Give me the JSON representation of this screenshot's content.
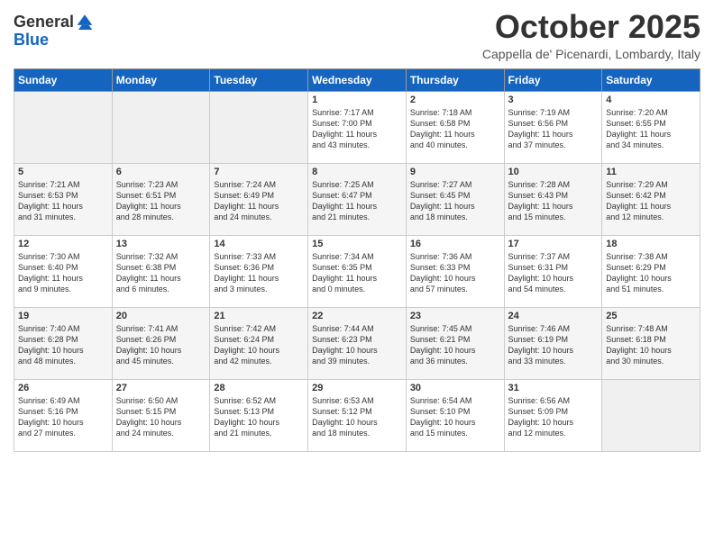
{
  "header": {
    "logo_line1": "General",
    "logo_line2": "Blue",
    "month": "October 2025",
    "location": "Cappella de' Picenardi, Lombardy, Italy"
  },
  "days_of_week": [
    "Sunday",
    "Monday",
    "Tuesday",
    "Wednesday",
    "Thursday",
    "Friday",
    "Saturday"
  ],
  "weeks": [
    [
      {
        "day": "",
        "info": ""
      },
      {
        "day": "",
        "info": ""
      },
      {
        "day": "",
        "info": ""
      },
      {
        "day": "1",
        "info": "Sunrise: 7:17 AM\nSunset: 7:00 PM\nDaylight: 11 hours\nand 43 minutes."
      },
      {
        "day": "2",
        "info": "Sunrise: 7:18 AM\nSunset: 6:58 PM\nDaylight: 11 hours\nand 40 minutes."
      },
      {
        "day": "3",
        "info": "Sunrise: 7:19 AM\nSunset: 6:56 PM\nDaylight: 11 hours\nand 37 minutes."
      },
      {
        "day": "4",
        "info": "Sunrise: 7:20 AM\nSunset: 6:55 PM\nDaylight: 11 hours\nand 34 minutes."
      }
    ],
    [
      {
        "day": "5",
        "info": "Sunrise: 7:21 AM\nSunset: 6:53 PM\nDaylight: 11 hours\nand 31 minutes."
      },
      {
        "day": "6",
        "info": "Sunrise: 7:23 AM\nSunset: 6:51 PM\nDaylight: 11 hours\nand 28 minutes."
      },
      {
        "day": "7",
        "info": "Sunrise: 7:24 AM\nSunset: 6:49 PM\nDaylight: 11 hours\nand 24 minutes."
      },
      {
        "day": "8",
        "info": "Sunrise: 7:25 AM\nSunset: 6:47 PM\nDaylight: 11 hours\nand 21 minutes."
      },
      {
        "day": "9",
        "info": "Sunrise: 7:27 AM\nSunset: 6:45 PM\nDaylight: 11 hours\nand 18 minutes."
      },
      {
        "day": "10",
        "info": "Sunrise: 7:28 AM\nSunset: 6:43 PM\nDaylight: 11 hours\nand 15 minutes."
      },
      {
        "day": "11",
        "info": "Sunrise: 7:29 AM\nSunset: 6:42 PM\nDaylight: 11 hours\nand 12 minutes."
      }
    ],
    [
      {
        "day": "12",
        "info": "Sunrise: 7:30 AM\nSunset: 6:40 PM\nDaylight: 11 hours\nand 9 minutes."
      },
      {
        "day": "13",
        "info": "Sunrise: 7:32 AM\nSunset: 6:38 PM\nDaylight: 11 hours\nand 6 minutes."
      },
      {
        "day": "14",
        "info": "Sunrise: 7:33 AM\nSunset: 6:36 PM\nDaylight: 11 hours\nand 3 minutes."
      },
      {
        "day": "15",
        "info": "Sunrise: 7:34 AM\nSunset: 6:35 PM\nDaylight: 11 hours\nand 0 minutes."
      },
      {
        "day": "16",
        "info": "Sunrise: 7:36 AM\nSunset: 6:33 PM\nDaylight: 10 hours\nand 57 minutes."
      },
      {
        "day": "17",
        "info": "Sunrise: 7:37 AM\nSunset: 6:31 PM\nDaylight: 10 hours\nand 54 minutes."
      },
      {
        "day": "18",
        "info": "Sunrise: 7:38 AM\nSunset: 6:29 PM\nDaylight: 10 hours\nand 51 minutes."
      }
    ],
    [
      {
        "day": "19",
        "info": "Sunrise: 7:40 AM\nSunset: 6:28 PM\nDaylight: 10 hours\nand 48 minutes."
      },
      {
        "day": "20",
        "info": "Sunrise: 7:41 AM\nSunset: 6:26 PM\nDaylight: 10 hours\nand 45 minutes."
      },
      {
        "day": "21",
        "info": "Sunrise: 7:42 AM\nSunset: 6:24 PM\nDaylight: 10 hours\nand 42 minutes."
      },
      {
        "day": "22",
        "info": "Sunrise: 7:44 AM\nSunset: 6:23 PM\nDaylight: 10 hours\nand 39 minutes."
      },
      {
        "day": "23",
        "info": "Sunrise: 7:45 AM\nSunset: 6:21 PM\nDaylight: 10 hours\nand 36 minutes."
      },
      {
        "day": "24",
        "info": "Sunrise: 7:46 AM\nSunset: 6:19 PM\nDaylight: 10 hours\nand 33 minutes."
      },
      {
        "day": "25",
        "info": "Sunrise: 7:48 AM\nSunset: 6:18 PM\nDaylight: 10 hours\nand 30 minutes."
      }
    ],
    [
      {
        "day": "26",
        "info": "Sunrise: 6:49 AM\nSunset: 5:16 PM\nDaylight: 10 hours\nand 27 minutes."
      },
      {
        "day": "27",
        "info": "Sunrise: 6:50 AM\nSunset: 5:15 PM\nDaylight: 10 hours\nand 24 minutes."
      },
      {
        "day": "28",
        "info": "Sunrise: 6:52 AM\nSunset: 5:13 PM\nDaylight: 10 hours\nand 21 minutes."
      },
      {
        "day": "29",
        "info": "Sunrise: 6:53 AM\nSunset: 5:12 PM\nDaylight: 10 hours\nand 18 minutes."
      },
      {
        "day": "30",
        "info": "Sunrise: 6:54 AM\nSunset: 5:10 PM\nDaylight: 10 hours\nand 15 minutes."
      },
      {
        "day": "31",
        "info": "Sunrise: 6:56 AM\nSunset: 5:09 PM\nDaylight: 10 hours\nand 12 minutes."
      },
      {
        "day": "",
        "info": ""
      }
    ]
  ]
}
